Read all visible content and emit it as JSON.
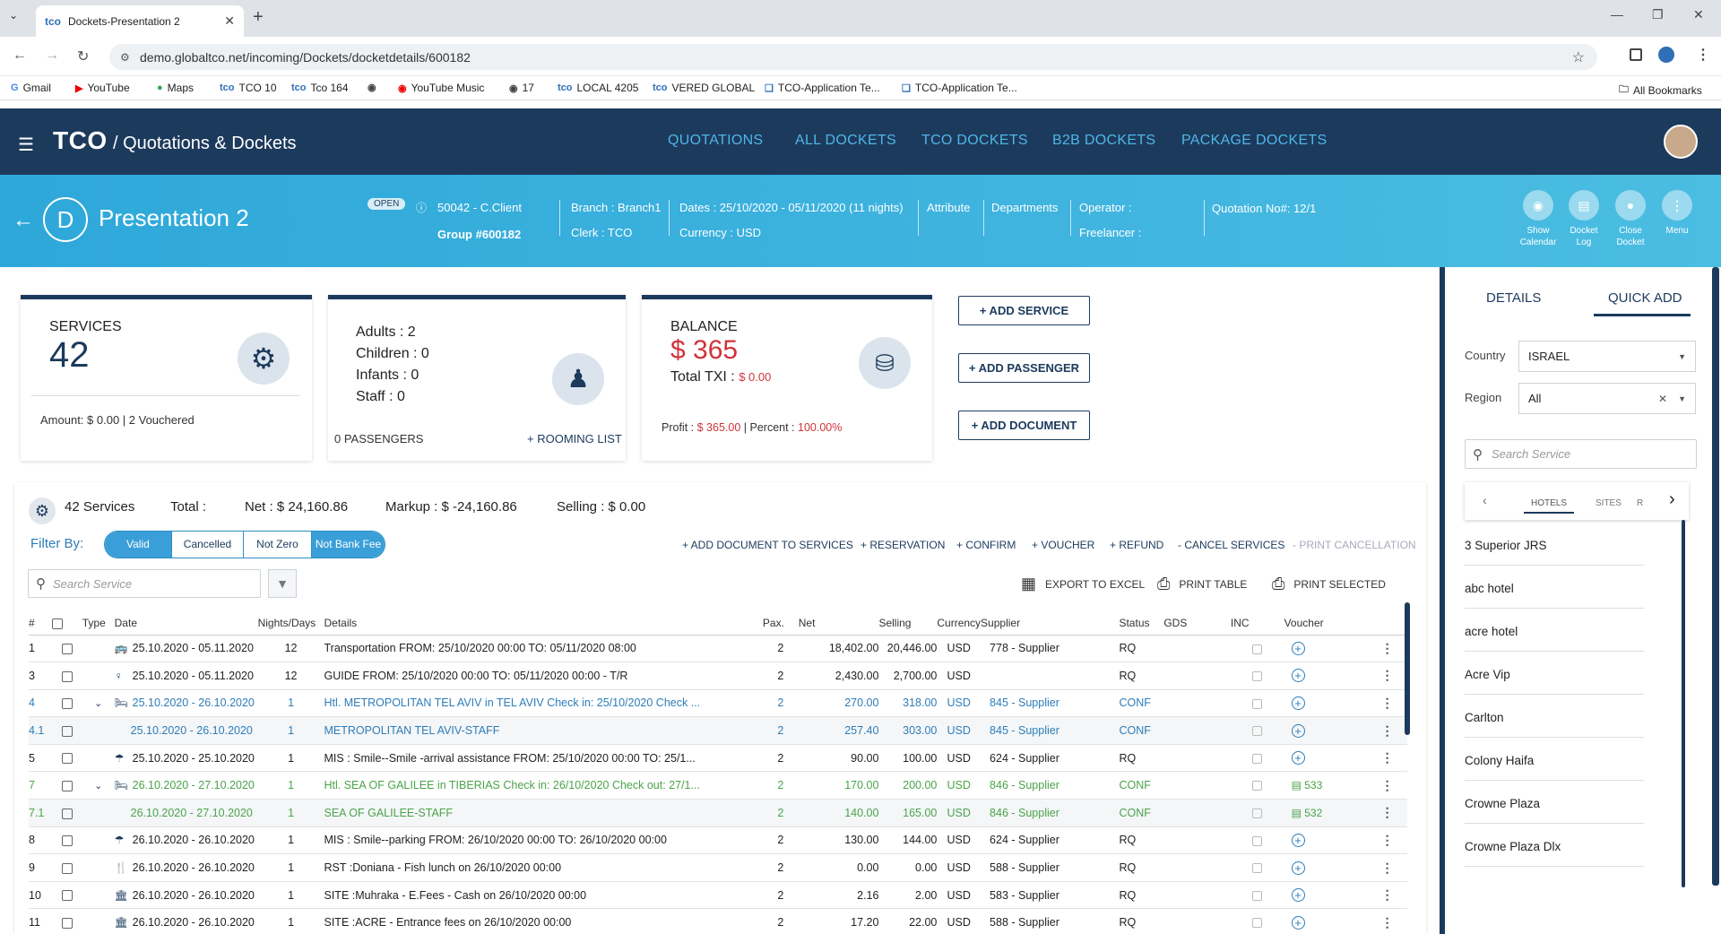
{
  "browser": {
    "tab_title": "Dockets-Presentation 2",
    "url": "demo.globaltco.net/incoming/Dockets/docketdetails/600182",
    "bookmarks": [
      "Gmail",
      "YouTube",
      "Maps",
      "TCO 10",
      "Tco 164",
      "",
      "YouTube Music",
      "17",
      "LOCAL 4205",
      "VERED GLOBAL",
      "TCO-Application Te...",
      "TCO-Application Te..."
    ],
    "all_bookmarks": "All Bookmarks"
  },
  "app": {
    "brand": "TCO",
    "subtitle": "/ Quotations & Dockets",
    "nav": [
      "QUOTATIONS",
      "ALL DOCKETS",
      "TCO DOCKETS",
      "B2B DOCKETS",
      "PACKAGE DOCKETS"
    ]
  },
  "docket": {
    "initial": "D",
    "title": "Presentation 2",
    "status": "OPEN",
    "client": "50042 - C.Client",
    "group": "Group #600182",
    "branch": "Branch : Branch1",
    "clerk": "Clerk : TCO",
    "dates": "Dates : 25/10/2020 - 05/11/2020 (11 nights)",
    "currency": "Currency : USD",
    "attribute": "Attribute",
    "departments": "Departments",
    "operator": "Operator :",
    "freelancer": "Freelancer :",
    "quotation": "Quotation No#: 12/1",
    "actions": [
      {
        "l1": "Show",
        "l2": "Calendar"
      },
      {
        "l1": "Docket",
        "l2": "Log"
      },
      {
        "l1": "Close",
        "l2": "Docket"
      },
      {
        "l1": "Menu",
        "l2": ""
      }
    ]
  },
  "cards": {
    "services_label": "SERVICES",
    "services_count": "42",
    "services_amount": "Amount: $ 0.00 | 2 Vouchered",
    "adults": "Adults : 2",
    "children": "Children : 0",
    "infants": "Infants : 0",
    "staff": "Staff : 0",
    "passengers": "0 PASSENGERS",
    "rooming": "+ ROOMING LIST",
    "balance_label": "BALANCE",
    "balance_value": "$ 365",
    "total_txi": "Total TXI :",
    "total_txi_value": "$ 0.00",
    "profit_label": "Profit :",
    "profit_value": "$ 365.00",
    "percent_label": "| Percent :",
    "percent_value": "100.00%"
  },
  "buttons": {
    "add_service": "+ ADD SERVICE",
    "add_passenger": "+ ADD PASSENGER",
    "add_document": "+ ADD DOCUMENT"
  },
  "services": {
    "count": "42 Services",
    "total": "Total :",
    "net": "Net : $ 24,160.86",
    "markup": "Markup : $ -24,160.86",
    "selling": "Selling : $ 0.00",
    "filter_by": "Filter By:",
    "filters": [
      "Valid",
      "Cancelled",
      "Not Zero",
      "Not Bank Fee"
    ],
    "actions": [
      "+ ADD DOCUMENT TO SERVICES",
      "+ RESERVATION",
      "+ CONFIRM",
      "+ VOUCHER",
      "+ REFUND",
      "- CANCEL SERVICES",
      "- PRINT CANCELLATION"
    ],
    "search_placeholder": "Search Service",
    "export": "EXPORT TO EXCEL",
    "print_table": "PRINT TABLE",
    "print_selected": "PRINT SELECTED",
    "columns": [
      "#",
      "Type",
      "Date",
      "Nights/Days",
      "Details",
      "Pax.",
      "Net",
      "Selling",
      "Currency",
      "Supplier",
      "Status",
      "GDS",
      "INC",
      "Voucher"
    ],
    "rows": [
      {
        "n": "1",
        "type": "bus",
        "date": "25.10.2020 - 05.11.2020",
        "nights": "12",
        "details": "Transportation FROM: 25/10/2020 00:00 TO: 05/11/2020 08:00",
        "pax": "2",
        "net": "18,402.00",
        "selling": "20,446.00",
        "cur": "USD",
        "supplier": "778 - Supplier",
        "status": "RQ",
        "voucher": "",
        "style": ""
      },
      {
        "n": "3",
        "type": "guide",
        "date": "25.10.2020 - 05.11.2020",
        "nights": "12",
        "details": "GUIDE FROM: 25/10/2020 00:00 TO: 05/11/2020 00:00 - T/R",
        "pax": "2",
        "net": "2,430.00",
        "selling": "2,700.00",
        "cur": "USD",
        "supplier": "",
        "status": "RQ",
        "voucher": "",
        "style": ""
      },
      {
        "n": "4",
        "type": "bed",
        "date": "25.10.2020 - 26.10.2020",
        "nights": "1",
        "details": "Htl. METROPOLITAN TEL AVIV in TEL AVIV Check in: 25/10/2020 Check ...",
        "pax": "2",
        "net": "270.00",
        "selling": "318.00",
        "cur": "USD",
        "supplier": "845 - Supplier",
        "status": "CONF",
        "voucher": "",
        "style": "blue",
        "expand": true
      },
      {
        "n": "4.1",
        "type": "",
        "date": "25.10.2020 - 26.10.2020",
        "nights": "1",
        "details": "METROPOLITAN TEL AVIV-STAFF",
        "pax": "2",
        "net": "257.40",
        "selling": "303.00",
        "cur": "USD",
        "supplier": "845 - Supplier",
        "status": "CONF",
        "voucher": "",
        "style": "blue sub"
      },
      {
        "n": "5",
        "type": "umbrella",
        "date": "25.10.2020 - 25.10.2020",
        "nights": "1",
        "details": "MIS : Smile--Smile -arrival assistance FROM: 25/10/2020 00:00 TO: 25/1...",
        "pax": "2",
        "net": "90.00",
        "selling": "100.00",
        "cur": "USD",
        "supplier": "624 - Supplier",
        "status": "RQ",
        "voucher": "",
        "style": ""
      },
      {
        "n": "7",
        "type": "bed",
        "date": "26.10.2020 - 27.10.2020",
        "nights": "1",
        "details": "Htl. SEA OF GALILEE in TIBERIAS Check in: 26/10/2020 Check out: 27/1...",
        "pax": "2",
        "net": "170.00",
        "selling": "200.00",
        "cur": "USD",
        "supplier": "846 - Supplier",
        "status": "CONF",
        "voucher": "533",
        "style": "green",
        "expand": true
      },
      {
        "n": "7.1",
        "type": "",
        "date": "26.10.2020 - 27.10.2020",
        "nights": "1",
        "details": "SEA OF GALILEE-STAFF",
        "pax": "2",
        "net": "140.00",
        "selling": "165.00",
        "cur": "USD",
        "supplier": "846 - Supplier",
        "status": "CONF",
        "voucher": "532",
        "style": "green sub"
      },
      {
        "n": "8",
        "type": "umbrella",
        "date": "26.10.2020 - 26.10.2020",
        "nights": "1",
        "details": "MIS : Smile--parking FROM: 26/10/2020 00:00 TO: 26/10/2020 00:00",
        "pax": "2",
        "net": "130.00",
        "selling": "144.00",
        "cur": "USD",
        "supplier": "624 - Supplier",
        "status": "RQ",
        "voucher": "",
        "style": ""
      },
      {
        "n": "9",
        "type": "fork",
        "date": "26.10.2020 - 26.10.2020",
        "nights": "1",
        "details": "RST :Doniana - Fish lunch on 26/10/2020 00:00",
        "pax": "2",
        "net": "0.00",
        "selling": "0.00",
        "cur": "USD",
        "supplier": "588 - Supplier",
        "status": "RQ",
        "voucher": "",
        "style": ""
      },
      {
        "n": "10",
        "type": "museum",
        "date": "26.10.2020 - 26.10.2020",
        "nights": "1",
        "details": "SITE :Muhraka - E.Fees - Cash on 26/10/2020 00:00",
        "pax": "2",
        "net": "2.16",
        "selling": "2.00",
        "cur": "USD",
        "supplier": "583 - Supplier",
        "status": "RQ",
        "voucher": "",
        "style": ""
      },
      {
        "n": "11",
        "type": "museum",
        "date": "26.10.2020 - 26.10.2020",
        "nights": "1",
        "details": "SITE :ACRE - Entrance fees on 26/10/2020 00:00",
        "pax": "2",
        "net": "17.20",
        "selling": "22.00",
        "cur": "USD",
        "supplier": "588 - Supplier",
        "status": "RQ",
        "voucher": "",
        "style": ""
      }
    ]
  },
  "right_panel": {
    "tabs": [
      "DETAILS",
      "QUICK ADD"
    ],
    "country_label": "Country",
    "country_value": "ISRAEL",
    "region_label": "Region",
    "region_value": "All",
    "search_placeholder": "Search Service",
    "subtabs": [
      "HOTELS",
      "SITES",
      "R"
    ],
    "items": [
      "3 Superior JRS",
      "abc hotel",
      "acre hotel",
      "Acre Vip",
      "Carlton",
      "Colony Haifa",
      "Crowne Plaza",
      "Crowne Plaza Dlx"
    ]
  }
}
